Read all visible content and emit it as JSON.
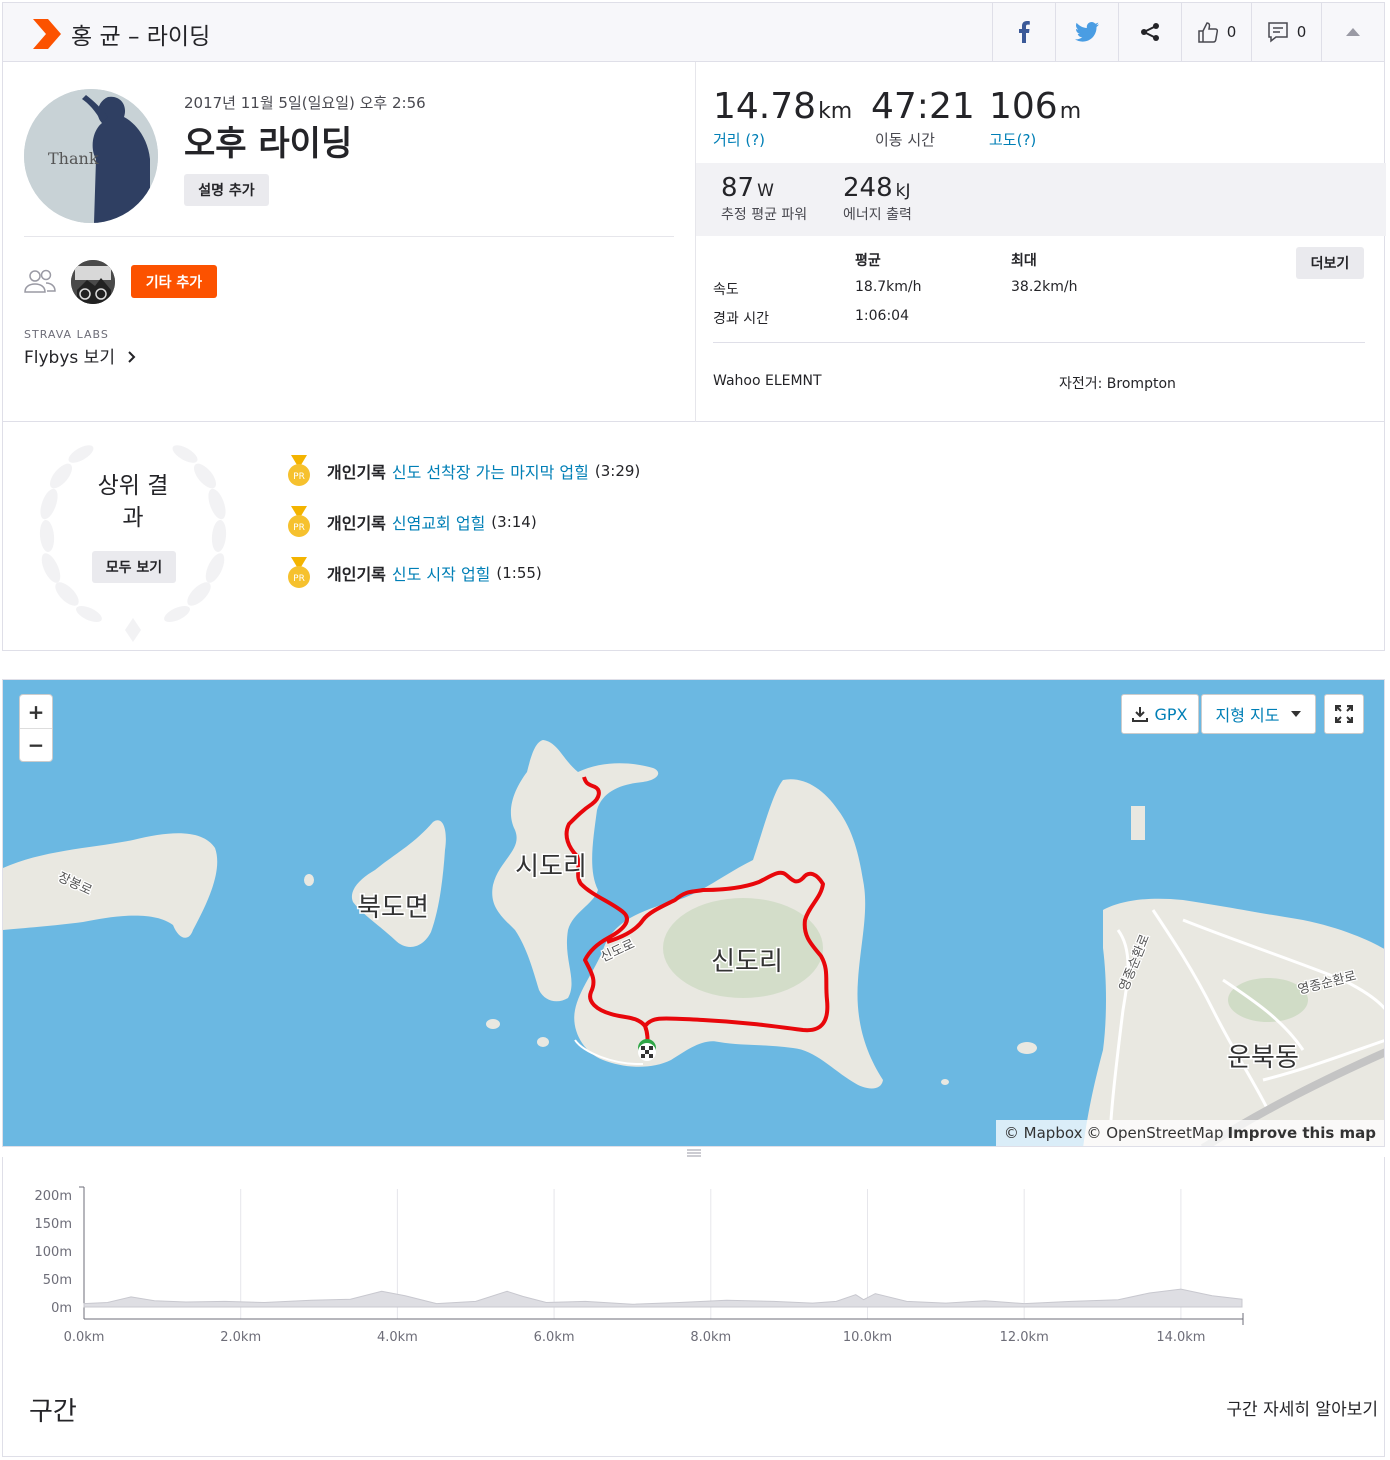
{
  "header": {
    "title": "홍 균 – 라이딩",
    "like_count": "0",
    "comment_count": "0"
  },
  "activity": {
    "date": "2017년 11월 5일(일요일) 오후 2:56",
    "name": "오후 라이딩",
    "add_description": "설명 추가",
    "avatar_text": "Thank",
    "add_others": "기타 추가",
    "labs": "STRAVA LABS",
    "flybys": "Flybys 보기"
  },
  "stats": {
    "distance": {
      "value": "14.78",
      "unit": "km",
      "label": "거리 (?)"
    },
    "moving_time": {
      "value": "47:21",
      "unit": "",
      "label": "이동 시간"
    },
    "elevation": {
      "value": "106",
      "unit": "m",
      "label": "고도(?)"
    },
    "power": {
      "value": "87",
      "unit": "W",
      "label": "추정 평균 파워"
    },
    "energy": {
      "value": "248",
      "unit": "kJ",
      "label": "에너지 출력"
    },
    "table": {
      "col_avg": "평균",
      "col_max": "최대",
      "rows": [
        {
          "label": "속도",
          "avg": "18.7km/h",
          "max": "38.2km/h"
        },
        {
          "label": "경과 시간",
          "avg": "1:06:04",
          "max": ""
        }
      ],
      "more": "더보기"
    },
    "device": "Wahoo ELEMNT",
    "bike": "자전거: Brompton"
  },
  "achievements": {
    "title": "상위 결과",
    "view_all": "모두 보기",
    "medal_text": "PR",
    "items": [
      {
        "kind": "개인기록",
        "segment": "신도 선착장 가는 마지막 업힐",
        "time": "(3:29)"
      },
      {
        "kind": "개인기록",
        "segment": "신염교회 업힐",
        "time": "(3:14)"
      },
      {
        "kind": "개인기록",
        "segment": "신도 시작 업힐",
        "time": "(1:55)"
      }
    ]
  },
  "map": {
    "zoom_in": "+",
    "zoom_out": "−",
    "gpx": "GPX",
    "map_type": "지형 지도",
    "labels": {
      "sido": "시도리",
      "bukdo": "북도면",
      "sindo": "신도리",
      "unbuk": "운북동",
      "road_jangbong": "장봉로",
      "road_sindo": "신도로",
      "road_yeongjong1": "영종순환로",
      "road_yeongjong2": "영종순환로"
    },
    "attribution": {
      "mapbox": "© Mapbox",
      "osm": "© OpenStreetMap",
      "improve": "Improve this map"
    },
    "colors": {
      "water": "#6bb8e2",
      "land": "#e9e8e1",
      "route": "#e8070b"
    }
  },
  "chart_data": {
    "type": "area",
    "x_unit": "km",
    "y_unit": "m",
    "y_ticks": [
      "0m",
      "50m",
      "100m",
      "150m",
      "200m"
    ],
    "x_ticks": [
      "0.0km",
      "2.0km",
      "4.0km",
      "6.0km",
      "8.0km",
      "10.0km",
      "12.0km",
      "14.0km"
    ],
    "xlim": [
      0,
      14.78
    ],
    "ylim": [
      0,
      200
    ],
    "x": [
      0,
      0.3,
      0.6,
      0.9,
      1.3,
      1.8,
      2.3,
      2.9,
      3.4,
      3.8,
      4.1,
      4.5,
      5.0,
      5.4,
      5.6,
      5.9,
      6.4,
      7.0,
      7.6,
      8.2,
      8.8,
      9.3,
      9.6,
      9.85,
      9.95,
      10.1,
      10.5,
      11.0,
      11.5,
      12.0,
      12.6,
      13.2,
      13.6,
      14.0,
      14.4,
      14.78
    ],
    "y": [
      6,
      8,
      18,
      11,
      9,
      10,
      8,
      12,
      14,
      28,
      20,
      6,
      10,
      28,
      19,
      8,
      10,
      5,
      8,
      12,
      10,
      7,
      10,
      22,
      13,
      24,
      10,
      7,
      11,
      6,
      10,
      13,
      25,
      32,
      20,
      14
    ],
    "grid": true,
    "fill_color": "#dedee3"
  },
  "segments": {
    "title": "구간",
    "learn_more": "구간 자세히 알아보기"
  }
}
